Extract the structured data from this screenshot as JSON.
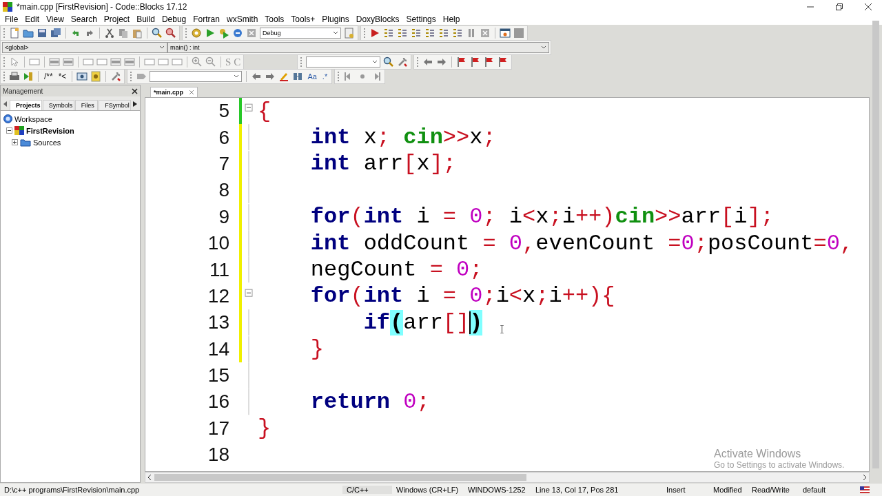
{
  "window": {
    "title": "*main.cpp [FirstRevision] - Code::Blocks 17.12"
  },
  "menu": [
    "File",
    "Edit",
    "View",
    "Search",
    "Project",
    "Build",
    "Debug",
    "Fortran",
    "wxSmith",
    "Tools",
    "Tools+",
    "Plugins",
    "DoxyBlocks",
    "Settings",
    "Help"
  ],
  "toolbars": {
    "build_target": "Debug",
    "scope": "<global>",
    "function": "main() : int",
    "style_buttons": [
      "S",
      "C"
    ],
    "comment_buttons": [
      "/**",
      "*<"
    ],
    "search_buttons": [
      "Aa",
      ".*"
    ]
  },
  "management": {
    "title": "Management",
    "tabs": [
      {
        "label": "Projects",
        "selected": true
      },
      {
        "label": "Symbols",
        "selected": false
      },
      {
        "label": "Files",
        "selected": false
      },
      {
        "label": "FSymbol",
        "selected": false
      }
    ],
    "tree": [
      {
        "label": "Workspace",
        "kind": "workspace",
        "children": [
          {
            "label": "FirstRevision",
            "kind": "project",
            "expanded": true,
            "children": [
              {
                "label": "Sources",
                "kind": "folder",
                "expanded": false
              }
            ]
          }
        ]
      }
    ]
  },
  "editor": {
    "tabs": [
      {
        "label": "*main.cpp",
        "selected": true
      }
    ],
    "lines": [
      {
        "number": "5",
        "color": "#28c828",
        "expanded": true,
        "tokens": [
          {
            "kind": "op",
            "text": "{"
          }
        ],
        "children": [
          {
            "number": "6",
            "color": "#f0f000",
            "tokens": [
              {
                "kind": "kw",
                "text": "int"
              },
              {
                "kind": "id",
                "text": " x"
              },
              {
                "kind": "op",
                "text": "; "
              },
              {
                "kind": "lib",
                "text": "cin"
              },
              {
                "kind": "op",
                "text": ">>"
              },
              {
                "kind": "id",
                "text": "x"
              },
              {
                "kind": "op",
                "text": ";"
              }
            ]
          },
          {
            "number": "7",
            "color": "#f0f000",
            "tokens": [
              {
                "kind": "kw",
                "text": "int"
              },
              {
                "kind": "id",
                "text": " arr"
              },
              {
                "kind": "op",
                "text": "["
              },
              {
                "kind": "id",
                "text": "x"
              },
              {
                "kind": "op",
                "text": "];"
              }
            ]
          },
          {
            "number": "8",
            "color": "#f0f000"
          },
          {
            "number": "9",
            "color": "#f0f000",
            "tokens": [
              {
                "kind": "kw",
                "text": "for"
              },
              {
                "kind": "op",
                "text": "("
              },
              {
                "kind": "kw",
                "text": "int"
              },
              {
                "kind": "id",
                "text": " i "
              },
              {
                "kind": "op",
                "text": "= "
              },
              {
                "kind": "num",
                "text": "0"
              },
              {
                "kind": "op",
                "text": ";"
              },
              {
                "kind": "id",
                "text": " i"
              },
              {
                "kind": "op",
                "text": "<"
              },
              {
                "kind": "id",
                "text": "x"
              },
              {
                "kind": "op",
                "text": ";"
              },
              {
                "kind": "id",
                "text": "i"
              },
              {
                "kind": "op",
                "text": "++)"
              },
              {
                "kind": "lib",
                "text": "cin"
              },
              {
                "kind": "op",
                "text": ">>"
              },
              {
                "kind": "id",
                "text": "arr"
              },
              {
                "kind": "op",
                "text": "["
              },
              {
                "kind": "id",
                "text": "i"
              },
              {
                "kind": "op",
                "text": "];"
              }
            ]
          },
          {
            "number": "10",
            "color": "#f0f000",
            "tokens": [
              {
                "kind": "kw",
                "text": "int"
              },
              {
                "kind": "id",
                "text": " oddCount "
              },
              {
                "kind": "op",
                "text": "= "
              },
              {
                "kind": "num",
                "text": "0"
              },
              {
                "kind": "op",
                "text": ","
              },
              {
                "kind": "id",
                "text": "evenCount "
              },
              {
                "kind": "op",
                "text": "="
              },
              {
                "kind": "num",
                "text": "0"
              },
              {
                "kind": "op",
                "text": ";"
              },
              {
                "kind": "id",
                "text": "posCount"
              },
              {
                "kind": "op",
                "text": "="
              },
              {
                "kind": "num",
                "text": "0"
              },
              {
                "kind": "op",
                "text": ","
              }
            ]
          },
          {
            "number": "11",
            "color": "#f0f000",
            "tokens": [
              {
                "kind": "id",
                "text": "negCount "
              },
              {
                "kind": "op",
                "text": "= "
              },
              {
                "kind": "num",
                "text": "0"
              },
              {
                "kind": "op",
                "text": ";"
              }
            ]
          },
          {
            "number": "12",
            "color": "#f0f000",
            "expanded": true,
            "tokens": [
              {
                "kind": "kw",
                "text": "for"
              },
              {
                "kind": "op",
                "text": "("
              },
              {
                "kind": "kw",
                "text": "int"
              },
              {
                "kind": "id",
                "text": " i "
              },
              {
                "kind": "op",
                "text": "= "
              },
              {
                "kind": "num",
                "text": "0"
              },
              {
                "kind": "op",
                "text": ";"
              },
              {
                "kind": "id",
                "text": "i"
              },
              {
                "kind": "op",
                "text": "<"
              },
              {
                "kind": "id",
                "text": "x"
              },
              {
                "kind": "op",
                "text": ";"
              },
              {
                "kind": "id",
                "text": "i"
              },
              {
                "kind": "op",
                "text": "++){"
              }
            ],
            "children": [
              {
                "number": "13",
                "color": "#f0f000",
                "tokens": [
                  {
                    "kind": "kw",
                    "text": "if",
                    "caret": false
                  },
                  {
                    "kind": "match",
                    "text": "(",
                    "caret": false
                  },
                  {
                    "kind": "id",
                    "text": "arr",
                    "caret": false
                  },
                  {
                    "kind": "op",
                    "text": "[]",
                    "caret": false
                  },
                  {
                    "kind": "match",
                    "text": ")",
                    "caret": true
                  }
                ]
              }
            ]
          },
          {
            "number": "14",
            "color": "#f0f000",
            "tokens": [
              {
                "kind": "op",
                "text": "}"
              }
            ]
          },
          {
            "number": "15"
          },
          {
            "number": "16",
            "tokens": [
              {
                "kind": "kw",
                "text": "return "
              },
              {
                "kind": "num",
                "text": "0"
              },
              {
                "kind": "op",
                "text": ";"
              }
            ]
          }
        ]
      },
      {
        "number": "17",
        "tokens": [
          {
            "kind": "op",
            "text": "}"
          }
        ]
      },
      {
        "number": "18"
      }
    ]
  },
  "os_notice": {
    "title": "Activate Windows",
    "text": "Go to Settings to activate Windows."
  },
  "status_bar": [
    "D:\\c++ programs\\FirstRevision\\main.cpp",
    "C/C++",
    "Windows (CR+LF)",
    "WINDOWS-1252",
    "Line 13, Col 17, Pos 281",
    "Insert",
    "Modified",
    "Read/Write",
    "default"
  ]
}
